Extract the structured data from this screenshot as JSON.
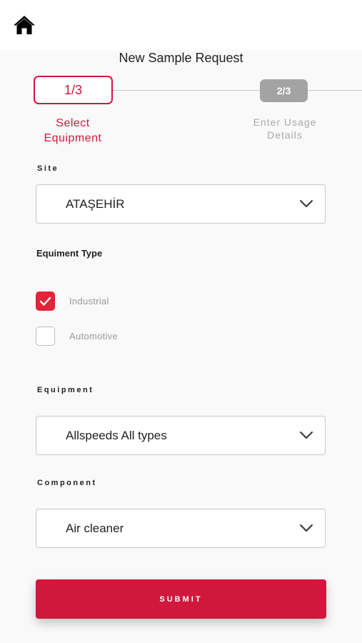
{
  "header": {
    "home_icon": "home-icon",
    "title": "New Sample Request"
  },
  "stepper": {
    "steps": [
      {
        "number": "1/3",
        "label_line1": "Select",
        "label_line2": "Equipment",
        "state": "active"
      },
      {
        "number": "2/3",
        "label_line1": "Enter Usage",
        "label_line2": "Details",
        "state": "inactive"
      }
    ]
  },
  "form": {
    "site": {
      "label": "Site",
      "value": "ATAŞEHİR"
    },
    "equipment_type": {
      "label": "Equiment Type",
      "options": [
        {
          "label": "Industrial",
          "checked": true
        },
        {
          "label": "Automotive",
          "checked": false
        }
      ]
    },
    "equipment": {
      "label": "Equipment",
      "value": "Allspeeds All types"
    },
    "component": {
      "label": "Component",
      "value": "Air cleaner"
    },
    "submit_label": "SUBMIT"
  },
  "colors": {
    "accent": "#d2173c",
    "checkbox_fill": "#e4233a",
    "inactive_step": "#a3a3a3",
    "background": "#f9f9f9"
  }
}
